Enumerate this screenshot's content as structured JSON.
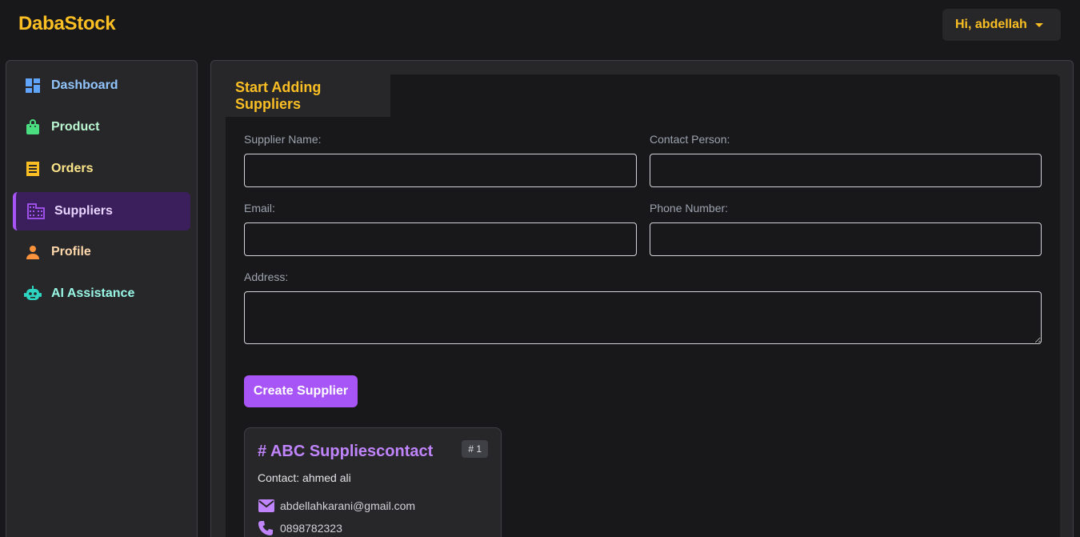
{
  "app": {
    "brand": "DabaStock"
  },
  "user_menu": {
    "greeting": "Hi, abdellah"
  },
  "sidebar": {
    "items": [
      {
        "label": "Dashboard",
        "icon": "dashboard-icon",
        "color": "#93c5fd",
        "icon_color": "#60a5fa"
      },
      {
        "label": "Product",
        "icon": "shopping-bag-icon",
        "color": "#bbf7d0",
        "icon_color": "#4ade80"
      },
      {
        "label": "Orders",
        "icon": "receipt-icon",
        "color": "#fde68a",
        "icon_color": "#fbbf24"
      },
      {
        "label": "Suppliers",
        "icon": "building-icon",
        "color": "#e9d5ff",
        "icon_color": "#a855f7",
        "active": true
      },
      {
        "label": "Profile",
        "icon": "person-icon",
        "color": "#fed7aa",
        "icon_color": "#fb923c"
      },
      {
        "label": "AI Assistance",
        "icon": "robot-icon",
        "color": "#99f6e4",
        "icon_color": "#2dd4bf"
      }
    ]
  },
  "form": {
    "tab_title": "Start Adding Suppliers",
    "supplier_name_label": "Supplier Name:",
    "contact_person_label": "Contact Person:",
    "email_label": "Email:",
    "phone_label": "Phone Number:",
    "address_label": "Address:",
    "supplier_name_value": "",
    "contact_person_value": "",
    "email_value": "",
    "phone_value": "",
    "address_value": "",
    "submit_label": "Create Supplier"
  },
  "suppliers": [
    {
      "title": "# ABC Suppliescontact",
      "badge": "# 1",
      "contact": "Contact: ahmed ali",
      "email": "abdellahkarani@gmail.com",
      "phone": "0898782323"
    }
  ],
  "colors": {
    "accent": "#a855f7",
    "brand": "#fbbf24",
    "background": "#18181b",
    "panel": "#27272a"
  }
}
